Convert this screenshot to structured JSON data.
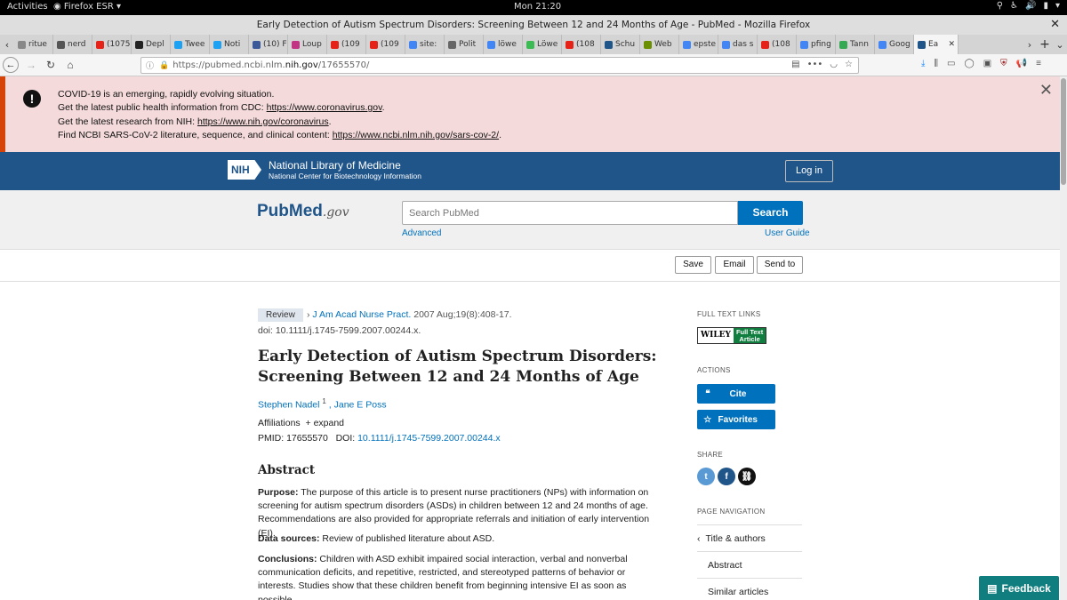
{
  "os": {
    "activities": "Activities",
    "app_name": "Firefox ESR",
    "clock": "Mon 21:20"
  },
  "window": {
    "title": "Early Detection of Autism Spectrum Disorders: Screening Between 12 and 24 Months of Age - PubMed - Mozilla Firefox"
  },
  "tabs": [
    {
      "label": "ritue",
      "color": "#888888"
    },
    {
      "label": "nerd",
      "color": "#555555"
    },
    {
      "label": "(1075",
      "color": "#e62117"
    },
    {
      "label": "Depl",
      "color": "#222222"
    },
    {
      "label": "Twee",
      "color": "#1da1f2"
    },
    {
      "label": "Noti",
      "color": "#1da1f2"
    },
    {
      "label": "(10) F",
      "color": "#3b5998"
    },
    {
      "label": "Loup",
      "color": "#c13584"
    },
    {
      "label": "(109",
      "color": "#e62117"
    },
    {
      "label": "(109",
      "color": "#e62117"
    },
    {
      "label": "site:",
      "color": "#4285f4"
    },
    {
      "label": "Polit",
      "color": "#666666"
    },
    {
      "label": "löwe",
      "color": "#4285f4"
    },
    {
      "label": "Löwe",
      "color": "#3cba54"
    },
    {
      "label": "(108",
      "color": "#e62117"
    },
    {
      "label": "Schu",
      "color": "#20558a"
    },
    {
      "label": "Web",
      "color": "#6a8f00"
    },
    {
      "label": "epste",
      "color": "#4285f4"
    },
    {
      "label": "das s",
      "color": "#4285f4"
    },
    {
      "label": "(108",
      "color": "#e62117"
    },
    {
      "label": "pfing",
      "color": "#4285f4"
    },
    {
      "label": "Tann",
      "color": "#34a853"
    },
    {
      "label": "Goog",
      "color": "#4285f4"
    },
    {
      "label": "Ea",
      "color": "#20558a",
      "active": true
    }
  ],
  "navbar": {
    "url_prefix": "https://pubmed.ncbi.nlm.",
    "url_host": "nih.gov",
    "url_path": "/17655570/"
  },
  "covid": {
    "line1": "COVID-19 is an emerging, rapidly evolving situation.",
    "line2_text": "Get the latest public health information from CDC: ",
    "line2_link": "https://www.coronavirus.gov",
    "line3_text": "Get the latest research from NIH: ",
    "line3_link": "https://www.nih.gov/coronavirus",
    "line4_text": "Find NCBI SARS-CoV-2 literature, sequence, and clinical content: ",
    "line4_link": "https://www.ncbi.nlm.nih.gov/sars-cov-2/"
  },
  "nih": {
    "badge": "NIH",
    "name": "National Library of Medicine",
    "subname": "National Center for Biotechnology Information",
    "login": "Log in"
  },
  "search": {
    "logo_pub": "Pub",
    "logo_med": "Med",
    "logo_gov": ".gov",
    "placeholder": "Search PubMed",
    "button": "Search",
    "advanced": "Advanced",
    "user_guide": "User Guide"
  },
  "actions_bar": {
    "save": "Save",
    "email": "Email",
    "send_to": "Send to"
  },
  "article": {
    "type": "Review",
    "journal": "J Am Acad Nurse Pract.",
    "citation": " 2007 Aug;19(8):408-17.",
    "doi_line": "doi: 10.1111/j.1745-7599.2007.00244.x.",
    "title": "Early Detection of Autism Spectrum Disorders: Screening Between 12 and 24 Months of Age",
    "author1": "Stephen Nadel",
    "author1_sup": "1",
    "author2": "Jane E Poss",
    "affiliations": "Affiliations",
    "expand": "expand",
    "pmid_label": "PMID: 17655570",
    "doi_label": "DOI: ",
    "doi_link": "10.1111/j.1745-7599.2007.00244.x",
    "abstract_heading": "Abstract",
    "purpose_label": "Purpose:",
    "purpose_text": " The purpose of this article is to present nurse practitioners (NPs) with information on screening for autism spectrum disorders (ASDs) in children between 12 and 24 months of age. Recommendations are also provided for appropriate referrals and initiation of early intervention (EI).",
    "sources_label": "Data sources:",
    "sources_text": " Review of published literature about ASD.",
    "conclusions_label": "Conclusions:",
    "conclusions_text": " Children with ASD exhibit impaired social interaction, verbal and nonverbal communication deficits, and repetitive, restricted, and stereotyped patterns of behavior or interests. Studies show that these children benefit from beginning intensive EI as soon as possible."
  },
  "sidebar": {
    "full_text_heading": "FULL TEXT LINKS",
    "wiley": "WILEY",
    "full_text_1": "Full Text",
    "full_text_2": "Article",
    "actions_heading": "ACTIONS",
    "cite": "Cite",
    "favorites": "Favorites",
    "share_heading": "SHARE",
    "page_nav_heading": "PAGE NAVIGATION",
    "nav_items": [
      "Title & authors",
      "Abstract",
      "Similar articles"
    ]
  },
  "feedback": "Feedback"
}
